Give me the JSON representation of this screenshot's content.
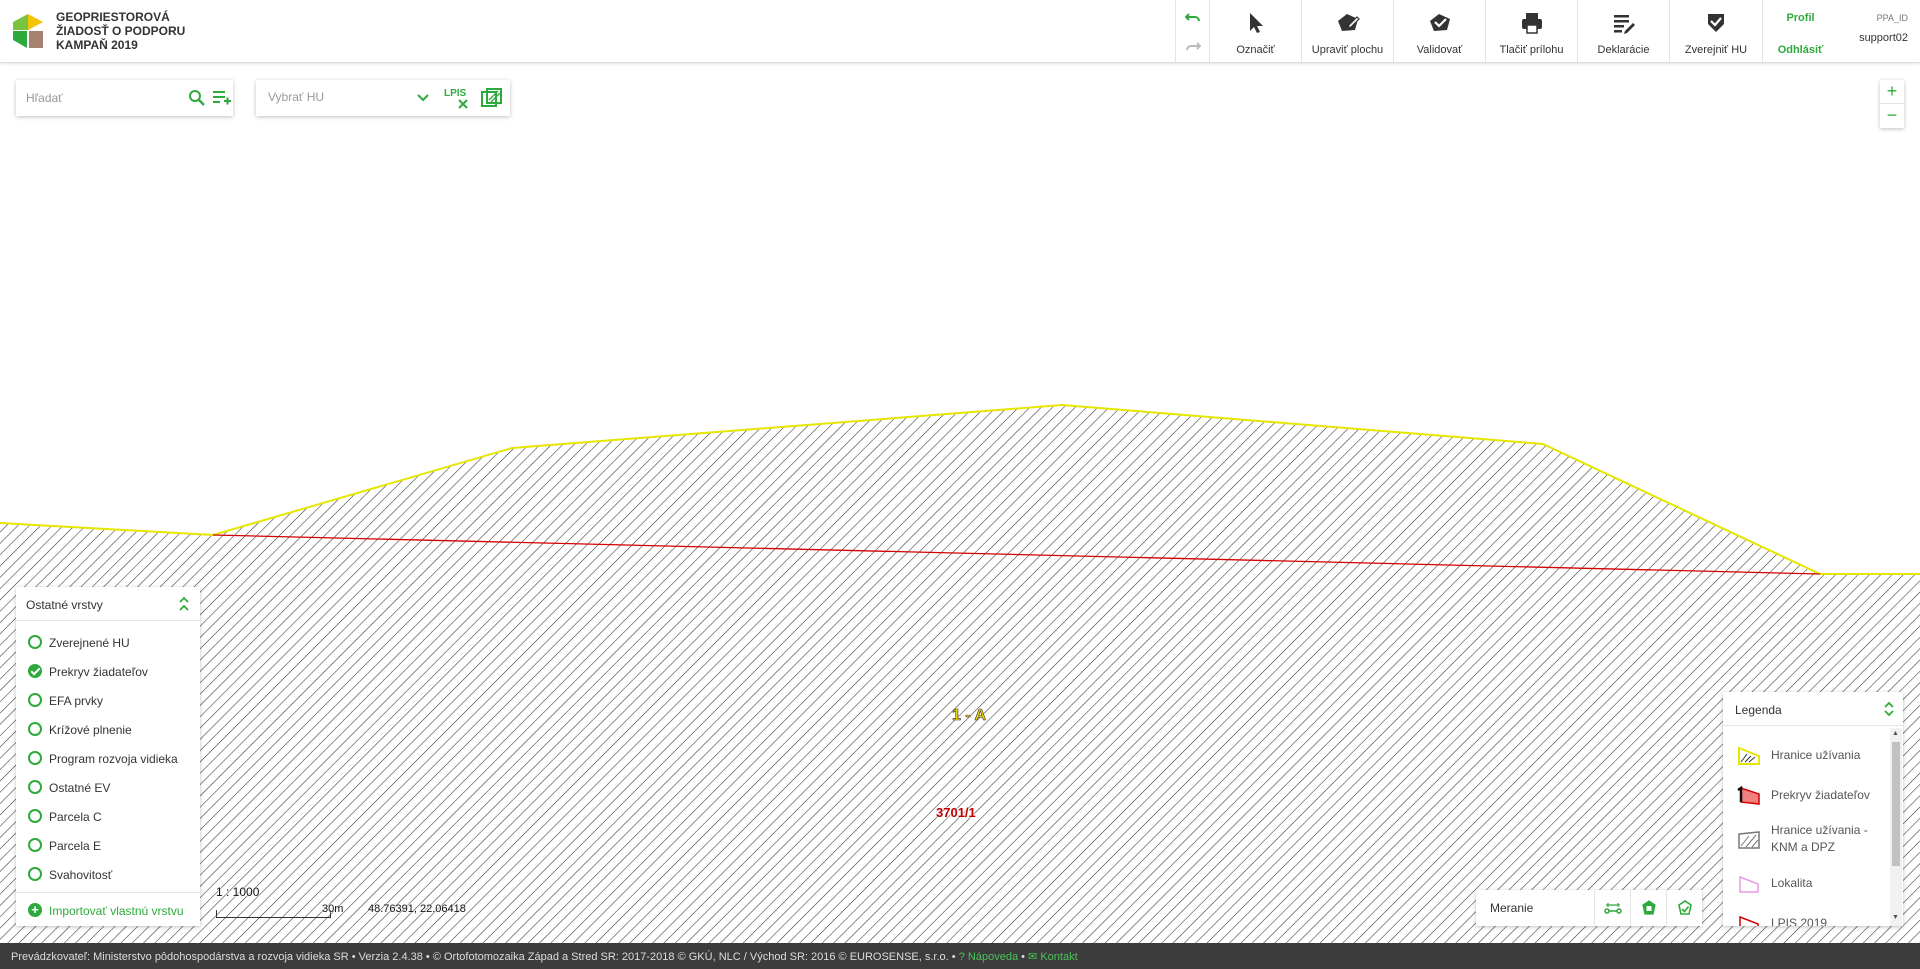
{
  "header": {
    "title_line1": "GEOPRIESTOROVÁ",
    "title_line2": "ŽIADOSŤ O PODPORU",
    "title_line3": "KAMPAŇ 2019",
    "tools": [
      {
        "label": "Označiť",
        "icon": "cursor-arrow-icon"
      },
      {
        "label": "Upraviť plochu",
        "icon": "edit-polygon-icon"
      },
      {
        "label": "Validovať",
        "icon": "validate-polygon-icon"
      },
      {
        "label": "Tlačiť prílohu",
        "icon": "printer-icon"
      },
      {
        "label": "Deklarácie",
        "icon": "declaration-list-icon"
      },
      {
        "label": "Zverejniť HU",
        "icon": "shield-check-icon"
      }
    ],
    "profile_label": "Profil",
    "logout_label": "Odhlásiť",
    "user_id_label": "PPA_ID",
    "user_name": "support02"
  },
  "search": {
    "placeholder": "Hľadať"
  },
  "hu_select": {
    "placeholder": "Vybrať HU",
    "lpis_label": "LPIS"
  },
  "map": {
    "polygon_label": "1 - A",
    "parcel_label": "3701/1",
    "scale": "1 : 1000",
    "scale_bar_label": "30m",
    "coordinates": "48.76391, 22.06418",
    "colors": {
      "usage_boundary": "#e6e600",
      "applicant_overlap": "#d40000",
      "hatch": "#333333",
      "accent": "#2eaa3c"
    }
  },
  "layers": {
    "title": "Ostatné vrstvy",
    "items": [
      {
        "label": "Zverejnené HU",
        "checked": false
      },
      {
        "label": "Prekryv žiadateľov",
        "checked": true
      },
      {
        "label": "EFA prvky",
        "checked": false
      },
      {
        "label": "Krížové plnenie",
        "checked": false
      },
      {
        "label": "Program rozvoja vidieka",
        "checked": false
      },
      {
        "label": "Ostatné EV",
        "checked": false
      },
      {
        "label": "Parcela C",
        "checked": false
      },
      {
        "label": "Parcela E",
        "checked": false
      },
      {
        "label": "Svahovitosť",
        "checked": false
      }
    ],
    "import_label": "Importovať vlastnú vrstvu"
  },
  "measure": {
    "label": "Meranie"
  },
  "legend": {
    "title": "Legenda",
    "items": [
      {
        "label": "Hranice užívania"
      },
      {
        "label": "Prekryv žiadateľov"
      },
      {
        "label": "Hranice užívania - KNM a DPZ"
      },
      {
        "label": "Lokalita"
      },
      {
        "label": "LPIS 2019"
      }
    ]
  },
  "footer": {
    "provider": "Prevádzkovateľ: Ministerstvo pôdohospodárstva a rozvoja vidieka SR",
    "version": "Verzia 2.4.38",
    "ortho": "© Ortofotomozaika Západ a Stred SR: 2017-2018 © GKÚ, NLC / Východ SR: 2016 © EUROSENSE, s.r.o.",
    "help_label": "Nápoveda",
    "contact_label": "Kontakt"
  }
}
